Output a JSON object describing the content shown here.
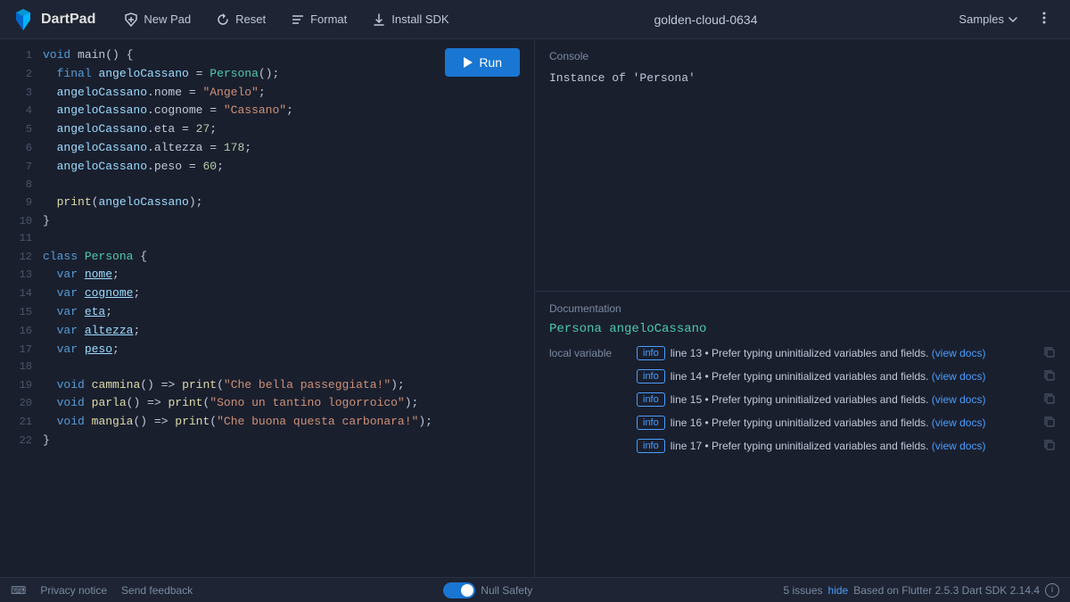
{
  "header": {
    "logo_text": "DartPad",
    "new_pad_label": "New Pad",
    "reset_label": "Reset",
    "format_label": "Format",
    "install_sdk_label": "Install SDK",
    "project_name": "golden-cloud-0634",
    "samples_label": "Samples"
  },
  "editor": {
    "run_label": "Run",
    "lines": [
      {
        "num": "1",
        "html": "<span class='kw'>void</span> main() {"
      },
      {
        "num": "2",
        "html": "  <span class='kw'>final</span> <span class='arg'>angeloCassano</span> = <span class='cls'>Persona</span>();"
      },
      {
        "num": "3",
        "html": "  <span class='arg'>angeloCassano</span>.nome = <span class='str'>\"Angelo\"</span>;"
      },
      {
        "num": "4",
        "html": "  <span class='arg'>angeloCassano</span>.cognome = <span class='str'>\"Cassano\"</span>;"
      },
      {
        "num": "5",
        "html": "  <span class='arg'>angeloCassano</span>.eta = <span class='num'>27</span>;"
      },
      {
        "num": "6",
        "html": "  <span class='arg'>angeloCassano</span>.altezza = <span class='num'>178</span>;"
      },
      {
        "num": "7",
        "html": "  <span class='arg'>angeloCassano</span>.peso = <span class='num'>60</span>;"
      },
      {
        "num": "8",
        "html": ""
      },
      {
        "num": "9",
        "html": "  <span class='print-fn'>print</span>(<span class='arg'>angeloCassano</span>);"
      },
      {
        "num": "10",
        "html": "}"
      },
      {
        "num": "11",
        "html": ""
      },
      {
        "num": "12",
        "html": "<span class='kw'>class</span> <span class='cls'>Persona</span> {"
      },
      {
        "num": "13",
        "html": "  <span class='kw'>var</span> <span class='var-underline'>nome</span>;"
      },
      {
        "num": "14",
        "html": "  <span class='kw'>var</span> <span class='var-underline'>cognome</span>;"
      },
      {
        "num": "15",
        "html": "  <span class='kw'>var</span> <span class='var-underline'>eta</span>;"
      },
      {
        "num": "16",
        "html": "  <span class='kw'>var</span> <span class='var-underline'>altezza</span>;"
      },
      {
        "num": "17",
        "html": "  <span class='kw'>var</span> <span class='var-underline'>peso</span>;"
      },
      {
        "num": "18",
        "html": ""
      },
      {
        "num": "19",
        "html": "  <span class='kw'>void</span> <span class='fn'>cammina</span>() => <span class='print-fn'>print</span>(<span class='str'>\"Che bella passeggiata!\"</span>);"
      },
      {
        "num": "20",
        "html": "  <span class='kw'>void</span> <span class='fn'>parla</span>() => <span class='print-fn'>print</span>(<span class='str'>\"Sono un tantino logorroico\"</span>);"
      },
      {
        "num": "21",
        "html": "  <span class='kw'>void</span> <span class='fn'>mangia</span>() => <span class='print-fn'>print</span>(<span class='str'>\"Che buona questa carbonara!\"</span>);"
      },
      {
        "num": "22",
        "html": "}"
      }
    ]
  },
  "console": {
    "label": "Console",
    "output": "Instance of 'Persona'"
  },
  "documentation": {
    "label": "Documentation",
    "symbol": "Persona angeloCassano",
    "type_label": "local variable",
    "items": [
      {
        "badge": "info",
        "text": "line 13 • Prefer typing uninitialized variables and fields.",
        "link_text": "(view docs)"
      },
      {
        "badge": "info",
        "text": "line 14 • Prefer typing uninitialized variables and fields.",
        "link_text": "(view docs)"
      },
      {
        "badge": "info",
        "text": "line 15 • Prefer typing uninitialized variables and fields.",
        "link_text": "(view docs)"
      },
      {
        "badge": "info",
        "text": "line 16 • Prefer typing uninitialized variables and fields.",
        "link_text": "(view docs)"
      },
      {
        "badge": "info",
        "text": "line 17 • Prefer typing uninitialized variables and fields.",
        "link_text": "(view docs)"
      }
    ]
  },
  "footer": {
    "kbd_icon": "⌨",
    "privacy_label": "Privacy notice",
    "feedback_label": "Send feedback",
    "null_safety_label": "Null Safety",
    "issues_count": "5 issues",
    "hide_label": "hide",
    "sdk_label": "Based on Flutter 2.5.3 Dart SDK 2.14.4"
  }
}
